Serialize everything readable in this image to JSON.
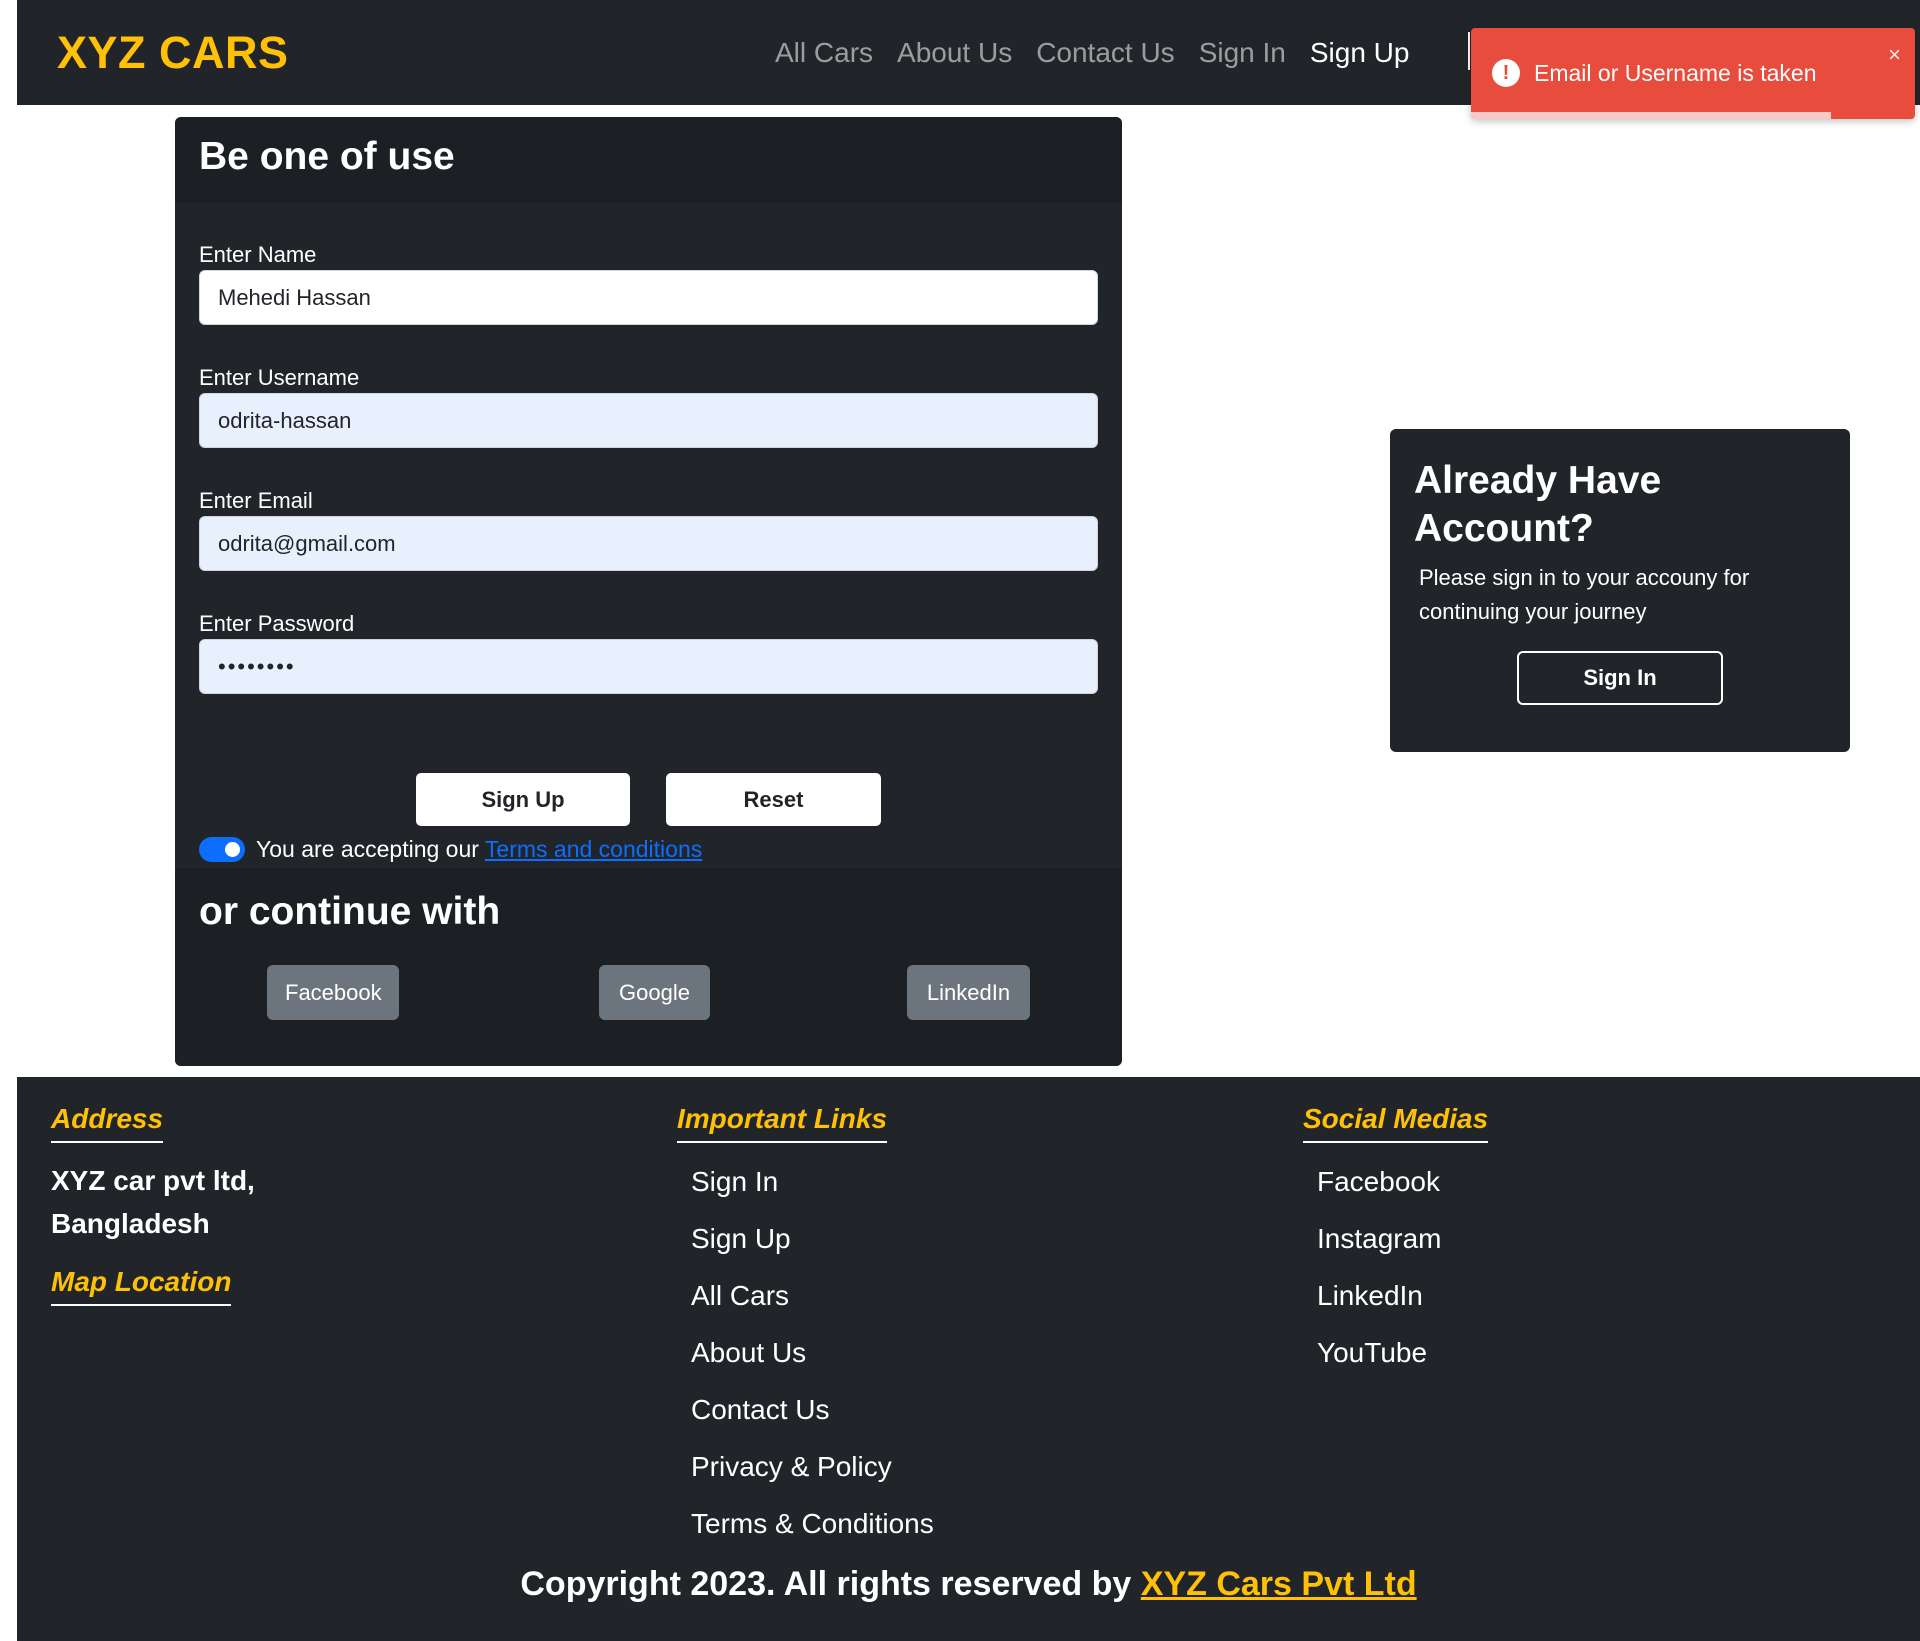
{
  "navbar": {
    "brand": "XYZ CARS",
    "links": [
      {
        "label": "All Cars",
        "active": false
      },
      {
        "label": "About Us",
        "active": false
      },
      {
        "label": "Contact Us",
        "active": false
      },
      {
        "label": "Sign In",
        "active": false
      },
      {
        "label": "Sign Up",
        "active": true
      }
    ]
  },
  "toast": {
    "icon": "!",
    "message": "Email or Username is taken",
    "close": "×",
    "progress_fraction": 0.81,
    "color": "#e74c3c"
  },
  "signup": {
    "title": "Be one of use",
    "fields": [
      {
        "label": "Enter Name",
        "value": "Mehedi Hassan",
        "type": "text"
      },
      {
        "label": "Enter Username",
        "value": "odrita-hassan",
        "type": "text"
      },
      {
        "label": "Enter Email",
        "value": "odrita@gmail.com",
        "type": "email"
      },
      {
        "label": "Enter Password",
        "value": "12345678",
        "type": "password"
      }
    ],
    "terms_prefix": "You are accepting our ",
    "terms_link": "Terms and conditions",
    "terms_accepted": true,
    "signup_button": "Sign Up",
    "reset_button": "Reset",
    "continue_title": "or continue with",
    "social_buttons": [
      "Facebook",
      "Google",
      "LinkedIn"
    ]
  },
  "account": {
    "title": "Already Have Account?",
    "text": "Please sign in to your accouny for continuing your journey",
    "button": "Sign In"
  },
  "footer": {
    "address_heading": "Address",
    "address": "XYZ car pvt ltd, Bangladesh",
    "map_heading": "Map Location",
    "links_heading": "Important Links",
    "links": [
      "Sign In",
      "Sign Up",
      "All Cars",
      "About Us",
      "Contact Us",
      "Privacy & Policy",
      "Terms & Conditions"
    ],
    "social_heading": "Social Medias",
    "social": [
      "Facebook",
      "Instagram",
      "LinkedIn",
      "YouTube"
    ],
    "copyright_prefix": "Copyright 2023. All rights reserved by ",
    "copyright_link": "XYZ Cars Pvt Ltd"
  },
  "colors": {
    "brand": "#ffc107",
    "dark": "#212529",
    "primary": "#0d6efd",
    "danger": "#e74c3c",
    "secondary": "#6c757d"
  }
}
